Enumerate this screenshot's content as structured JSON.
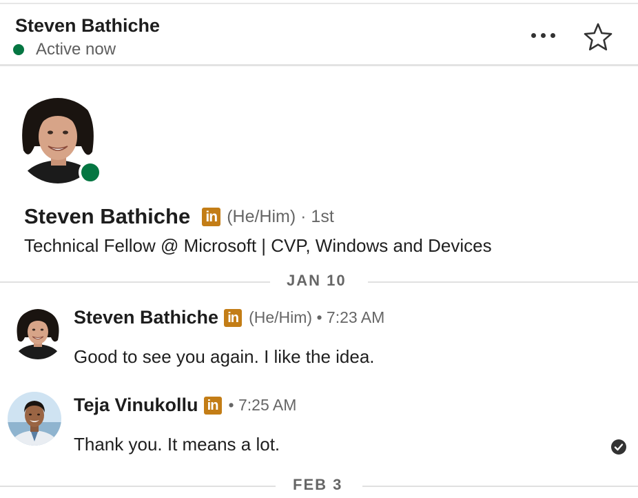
{
  "header": {
    "name": "Steven Bathiche",
    "status": "Active now",
    "more_icon": "more-horizontal-icon",
    "star_icon": "star-outline-icon"
  },
  "profile": {
    "name": "Steven Bathiche",
    "badge": "in",
    "pronouns": "(He/Him)",
    "degree": "· 1st",
    "headline": "Technical Fellow @ Microsoft | CVP, Windows and Devices",
    "online_color": "#057642"
  },
  "dividers": [
    {
      "label": "JAN 10"
    },
    {
      "label": "FEB 3"
    }
  ],
  "messages": [
    {
      "sender": "Steven Bathiche",
      "badge": "in",
      "meta": "(He/Him) • 7:23 AM",
      "text": "Good to see you again. I like the idea."
    },
    {
      "sender": "Teja Vinukollu",
      "badge": "in",
      "meta": "• 7:25 AM",
      "text": "Thank you. It means a lot.",
      "status_icon": "seen-check-icon"
    }
  ],
  "colors": {
    "online": "#057642",
    "linkedin_badge": "#c37d16",
    "divider": "#e0e0e0"
  }
}
